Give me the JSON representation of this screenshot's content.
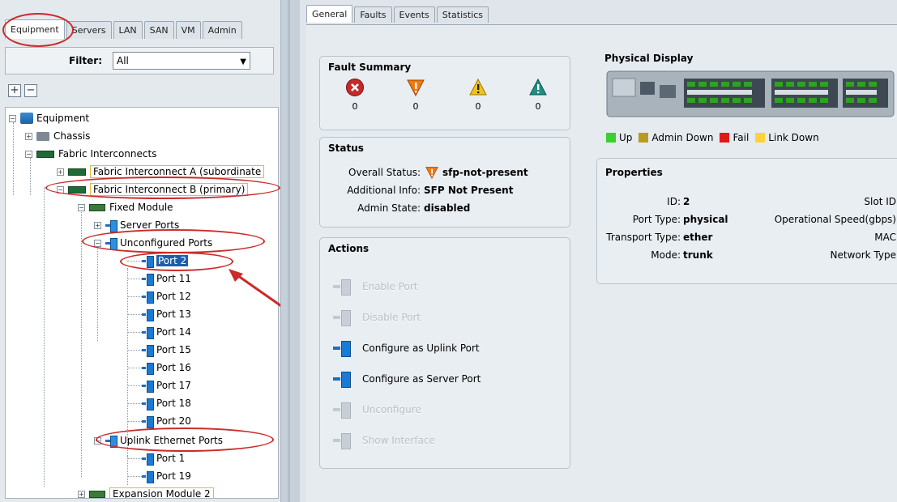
{
  "left_tabs": [
    "Equipment",
    "Servers",
    "LAN",
    "SAN",
    "VM",
    "Admin"
  ],
  "filter": {
    "label": "Filter:",
    "value": "All"
  },
  "tree": {
    "equipment": "Equipment",
    "chassis": "Chassis",
    "fabric_interconnects": "Fabric Interconnects",
    "fi_a": "Fabric Interconnect A (subordinate",
    "fi_b": "Fabric Interconnect B (primary)",
    "fixed_module": "Fixed Module",
    "server_ports": "Server Ports",
    "unconfigured_ports": "Unconfigured Ports",
    "unconfigured_list": [
      "Port 2",
      "Port 11",
      "Port 12",
      "Port 13",
      "Port 14",
      "Port 15",
      "Port 16",
      "Port 17",
      "Port 18",
      "Port 20"
    ],
    "uplink_ports": "Uplink Ethernet Ports",
    "uplink_list": [
      "Port 1",
      "Port 19"
    ],
    "expansion_module": "Expansion Module 2"
  },
  "right_tabs": [
    "General",
    "Faults",
    "Events",
    "Statistics"
  ],
  "fault_summary": {
    "title": "Fault Summary",
    "counts": [
      "0",
      "0",
      "0",
      "0"
    ]
  },
  "status": {
    "title": "Status",
    "overall_label": "Overall Status:",
    "overall_value": "sfp-not-present",
    "info_label": "Additional Info:",
    "info_value": "SFP Not Present",
    "admin_label": "Admin State:",
    "admin_value": "disabled"
  },
  "actions": {
    "title": "Actions",
    "items": [
      "Enable Port",
      "Disable Port",
      "Configure as Uplink Port",
      "Configure as Server Port",
      "Unconfigure",
      "Show Interface"
    ]
  },
  "physical_display": {
    "title": "Physical Display",
    "legend": [
      "Up",
      "Admin Down",
      "Fail",
      "Link Down"
    ],
    "legend_colors": [
      "#39d12b",
      "#b89a1e",
      "#e01818",
      "#ffd23a"
    ]
  },
  "properties": {
    "title": "Properties",
    "id_label": "ID:",
    "id_value": "2",
    "slot_label": "Slot ID",
    "port_type_label": "Port Type:",
    "port_type_value": "physical",
    "op_speed_label": "Operational Speed(gbps)",
    "transport_label": "Transport Type:",
    "transport_value": "ether",
    "mac_label": "MAC",
    "mode_label": "Mode:",
    "mode_value": "trunk",
    "network_type_label": "Network Type"
  }
}
